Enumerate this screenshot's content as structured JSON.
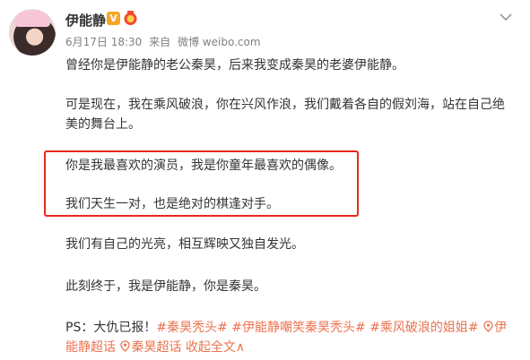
{
  "post": {
    "author": "伊能静",
    "vip_glyph": "V",
    "date": "6月17日 18:30",
    "source_prefix": "来自",
    "source": "微博 weibo.com",
    "paragraphs": [
      "曾经你是伊能静的老公秦昊，后来我变成秦昊的老婆伊能静。",
      "可是现在，我在乘风破浪，你在兴风作浪，我们戴着各自的假刘海，站在自己绝美的舞台上。",
      "你是我最喜欢的演员，我是你童年最喜欢的偶像。",
      "我们天生一对，也是绝对的棋逢对手。",
      "我们有自己的光亮，相互辉映又独自发光。",
      "此刻终于，我是伊能静，你是秦昊。"
    ],
    "ps_prefix": "PS：大仇已报！",
    "hashtags": [
      "#秦昊秃头#",
      "#伊能静嘲笑秦昊秃头#",
      "#乘风破浪的姐姐#"
    ],
    "super_topics": [
      "伊能静超话",
      "秦昊超话"
    ],
    "collapse_label": "收起全文",
    "collapse_arrow": "∧"
  },
  "colors": {
    "highlight": "#e8281e",
    "link": "#eb7350",
    "meta": "#808080"
  }
}
